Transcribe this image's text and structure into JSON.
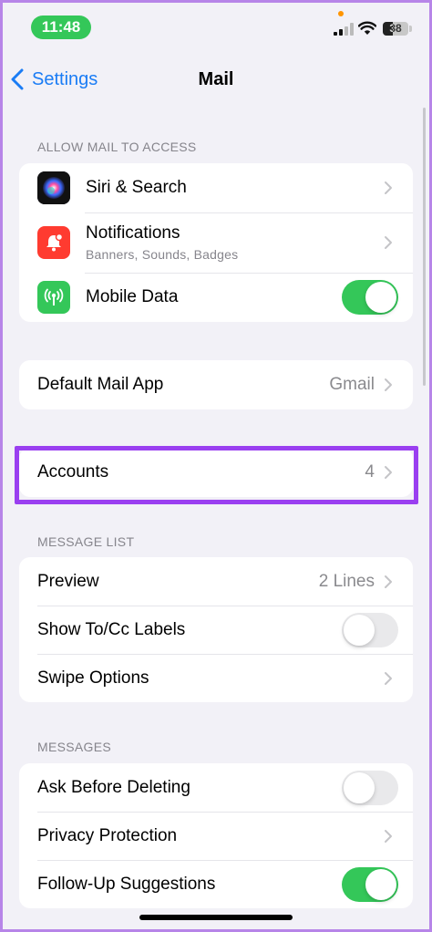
{
  "status_bar": {
    "time": "11:48",
    "battery": "38",
    "battery_level_percent": 38
  },
  "nav": {
    "back_label": "Settings",
    "title": "Mail"
  },
  "allow_access": {
    "header": "ALLOW MAIL TO ACCESS",
    "siri": {
      "label": "Siri & Search",
      "icon": "siri-icon"
    },
    "notifications": {
      "label": "Notifications",
      "subtitle": "Banners, Sounds, Badges",
      "icon": "notifications-icon"
    },
    "mobile_data": {
      "label": "Mobile Data",
      "enabled": true,
      "icon": "antenna-icon"
    }
  },
  "default_app": {
    "label": "Default Mail App",
    "value": "Gmail"
  },
  "accounts": {
    "label": "Accounts",
    "value": "4"
  },
  "message_list": {
    "header": "MESSAGE LIST",
    "preview": {
      "label": "Preview",
      "value": "2 Lines"
    },
    "show_tocc": {
      "label": "Show To/Cc Labels",
      "enabled": false
    },
    "swipe": {
      "label": "Swipe Options"
    }
  },
  "messages": {
    "header": "MESSAGES",
    "ask_delete": {
      "label": "Ask Before Deleting",
      "enabled": false
    },
    "privacy": {
      "label": "Privacy Protection"
    },
    "followup": {
      "label": "Follow-Up Suggestions",
      "enabled": true
    }
  },
  "colors": {
    "accent": "#1a7cf5",
    "toggle_on": "#34c759",
    "highlight": "#9a3ff0",
    "notifications_icon_bg": "#ff3b30",
    "mobile_data_icon_bg": "#34c759"
  }
}
